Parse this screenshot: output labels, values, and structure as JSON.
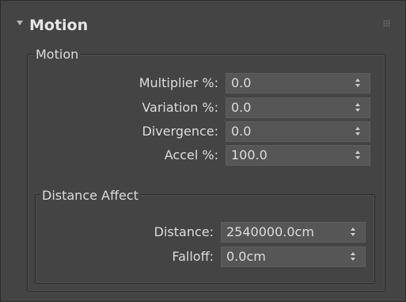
{
  "rollout": {
    "title": "Motion",
    "grip_icon": "grip-dots-icon",
    "arrow_icon": "triangle-down-icon"
  },
  "motion_group": {
    "legend": "Motion",
    "fields": [
      {
        "label": "Multiplier %:",
        "value": "0.0"
      },
      {
        "label": "Variation %:",
        "value": "0.0"
      },
      {
        "label": "Divergence:",
        "value": "0.0"
      },
      {
        "label": "Accel %:",
        "value": "100.0"
      }
    ]
  },
  "distance_group": {
    "legend": "Distance Affect",
    "fields": [
      {
        "label": "Distance:",
        "value": "2540000.0cm"
      },
      {
        "label": "Falloff:",
        "value": "0.0cm"
      }
    ]
  },
  "colors": {
    "panel_bg": "#444444",
    "field_bg": "#565656",
    "text": "#dcdcdc"
  }
}
